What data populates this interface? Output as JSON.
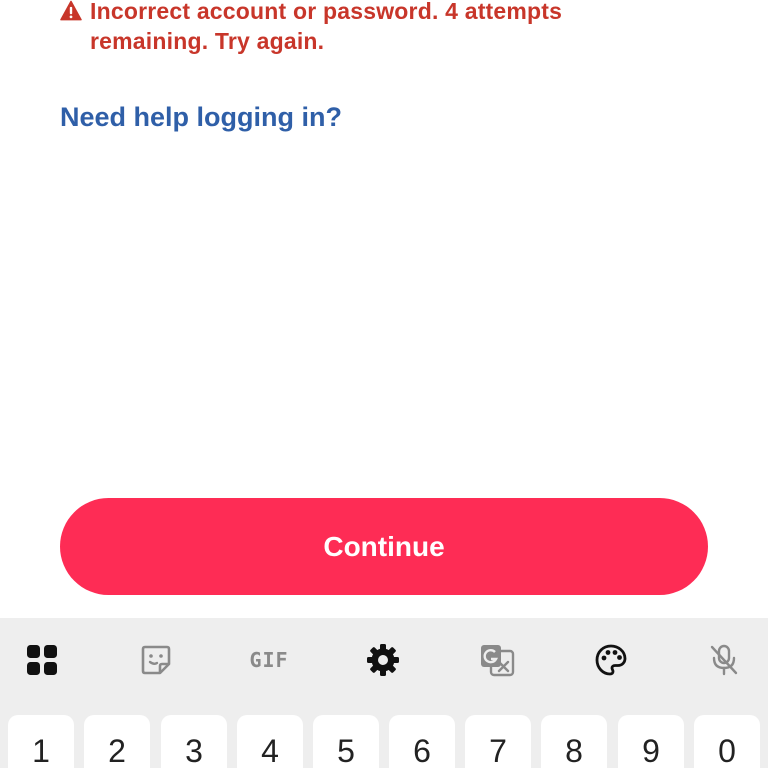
{
  "error": {
    "message": "Incorrect account or password. 4 attempts remaining. Try again.",
    "icon": "warning-triangle-icon",
    "color": "#c8362a"
  },
  "help_link": {
    "label": "Need help logging in?",
    "color": "#2f5fa8"
  },
  "continue_button": {
    "label": "Continue",
    "color": "#fe2c55"
  },
  "keyboard": {
    "toolbar": {
      "gif_label": "GIF",
      "icons": [
        "apps-grid-icon",
        "sticker-icon",
        "gif-icon",
        "settings-gear-icon",
        "translate-icon",
        "palette-icon",
        "mic-off-icon"
      ]
    },
    "number_keys": [
      "1",
      "2",
      "3",
      "4",
      "5",
      "6",
      "7",
      "8",
      "9",
      "0"
    ]
  }
}
